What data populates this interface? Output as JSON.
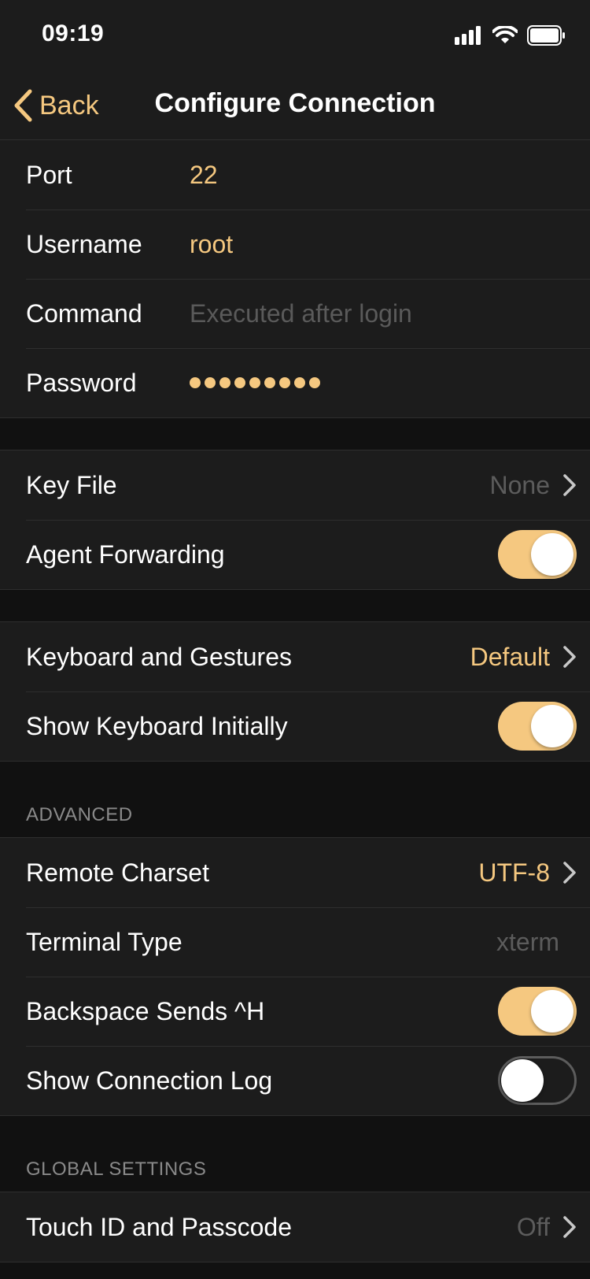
{
  "status": {
    "time": "09:19"
  },
  "nav": {
    "back_label": "Back",
    "title": "Configure Connection"
  },
  "connection": {
    "port": {
      "label": "Port",
      "value": "22"
    },
    "username": {
      "label": "Username",
      "value": "root"
    },
    "command": {
      "label": "Command",
      "placeholder": "Executed after login"
    },
    "password": {
      "label": "Password",
      "dots": 9
    }
  },
  "auth": {
    "key_file": {
      "label": "Key File",
      "value": "None"
    },
    "agent_forwarding": {
      "label": "Agent Forwarding",
      "on": true
    }
  },
  "keyboard": {
    "gestures": {
      "label": "Keyboard and Gestures",
      "value": "Default"
    },
    "show_initially": {
      "label": "Show Keyboard Initially",
      "on": true
    }
  },
  "advanced": {
    "header": "ADVANCED",
    "charset": {
      "label": "Remote Charset",
      "value": "UTF-8"
    },
    "terminal_type": {
      "label": "Terminal Type",
      "value": "xterm"
    },
    "backspace": {
      "label": "Backspace Sends ^H",
      "on": true
    },
    "connection_log": {
      "label": "Show Connection Log",
      "on": false
    }
  },
  "global": {
    "header": "GLOBAL SETTINGS",
    "touch_id": {
      "label": "Touch ID and Passcode",
      "value": "Off"
    }
  },
  "colors": {
    "accent": "#f5c880",
    "background": "#111111",
    "cell": "#1c1c1c",
    "separator": "#2e2e2e"
  },
  "icons": [
    "signal-icon",
    "wifi-icon",
    "battery-icon",
    "back-chevron-icon",
    "chevron-right-icon"
  ]
}
